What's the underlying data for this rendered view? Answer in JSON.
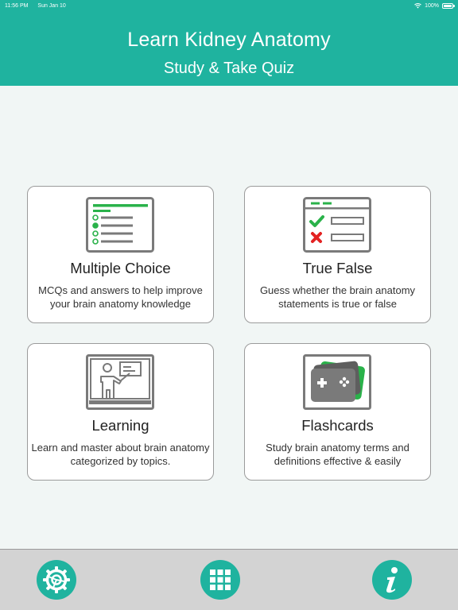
{
  "status_bar": {
    "time": "11:56 PM",
    "date": "Sun Jan 10",
    "battery": "100%",
    "battery_level": 1.0
  },
  "header": {
    "title": "Learn Kidney Anatomy",
    "subtitle": "Study & Take Quiz"
  },
  "cards": [
    {
      "icon": "checklist-icon",
      "title": "Multiple Choice",
      "desc_line1": "MCQs and answers to help improve",
      "desc_line2": "your brain anatomy knowledge"
    },
    {
      "icon": "true-false-icon",
      "title": "True False",
      "desc_line1": "Guess whether the brain anatomy",
      "desc_line2": "statements is true or false"
    },
    {
      "icon": "teacher-board-icon",
      "title": "Learning",
      "desc_line1": "Learn and master about brain anatomy",
      "desc_line2": "categorized by topics."
    },
    {
      "icon": "flashcards-gamepad-icon",
      "title": "Flashcards",
      "desc_line1": "Study brain anatomy terms and",
      "desc_line2": "definitions effective & easily"
    }
  ],
  "tab_bar": {
    "items": [
      {
        "icon": "settings-gear-icon"
      },
      {
        "icon": "grid-menu-icon"
      },
      {
        "icon": "info-icon"
      }
    ]
  },
  "colors": {
    "accent": "#1fb39f",
    "green": "#2ab24a",
    "red": "#e32222",
    "icon_gray": "#7a7a7a",
    "tab_bar_bg": "#d3d3d3",
    "page_bg": "#f1f6f5"
  }
}
